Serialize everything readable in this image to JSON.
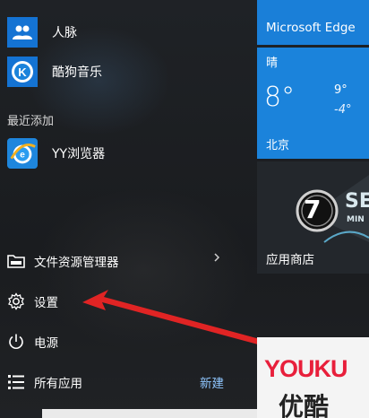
{
  "apps": [
    {
      "label": "人脉",
      "icon": "people-icon"
    },
    {
      "label": "酷狗音乐",
      "icon": "kugou-logo"
    }
  ],
  "recent_section": "最近添加",
  "recent_apps": [
    {
      "label": "YY浏览器",
      "icon": "yy-browser-logo"
    }
  ],
  "bottom_menu": {
    "file_explorer": "文件资源管理器",
    "settings": "设置",
    "power": "电源",
    "all_apps": "所有应用",
    "new": "新建"
  },
  "tiles": {
    "edge": {
      "label": "Microsoft Edge"
    },
    "weather": {
      "condition": "晴",
      "temp": "8°",
      "high": "9°",
      "low": "-4°",
      "city": "北京"
    },
    "store": {
      "label": "应用商店",
      "badge_number": "7",
      "promo_text_partial": "SE",
      "promo_text_small": "MIN"
    },
    "youku": {
      "logo_text": "YOUKU",
      "subtext": "优酷"
    }
  },
  "colors": {
    "tile_blue": "#1b83db",
    "accent_red_arrow": "#e02424",
    "new_link": "#8fc6ff"
  }
}
